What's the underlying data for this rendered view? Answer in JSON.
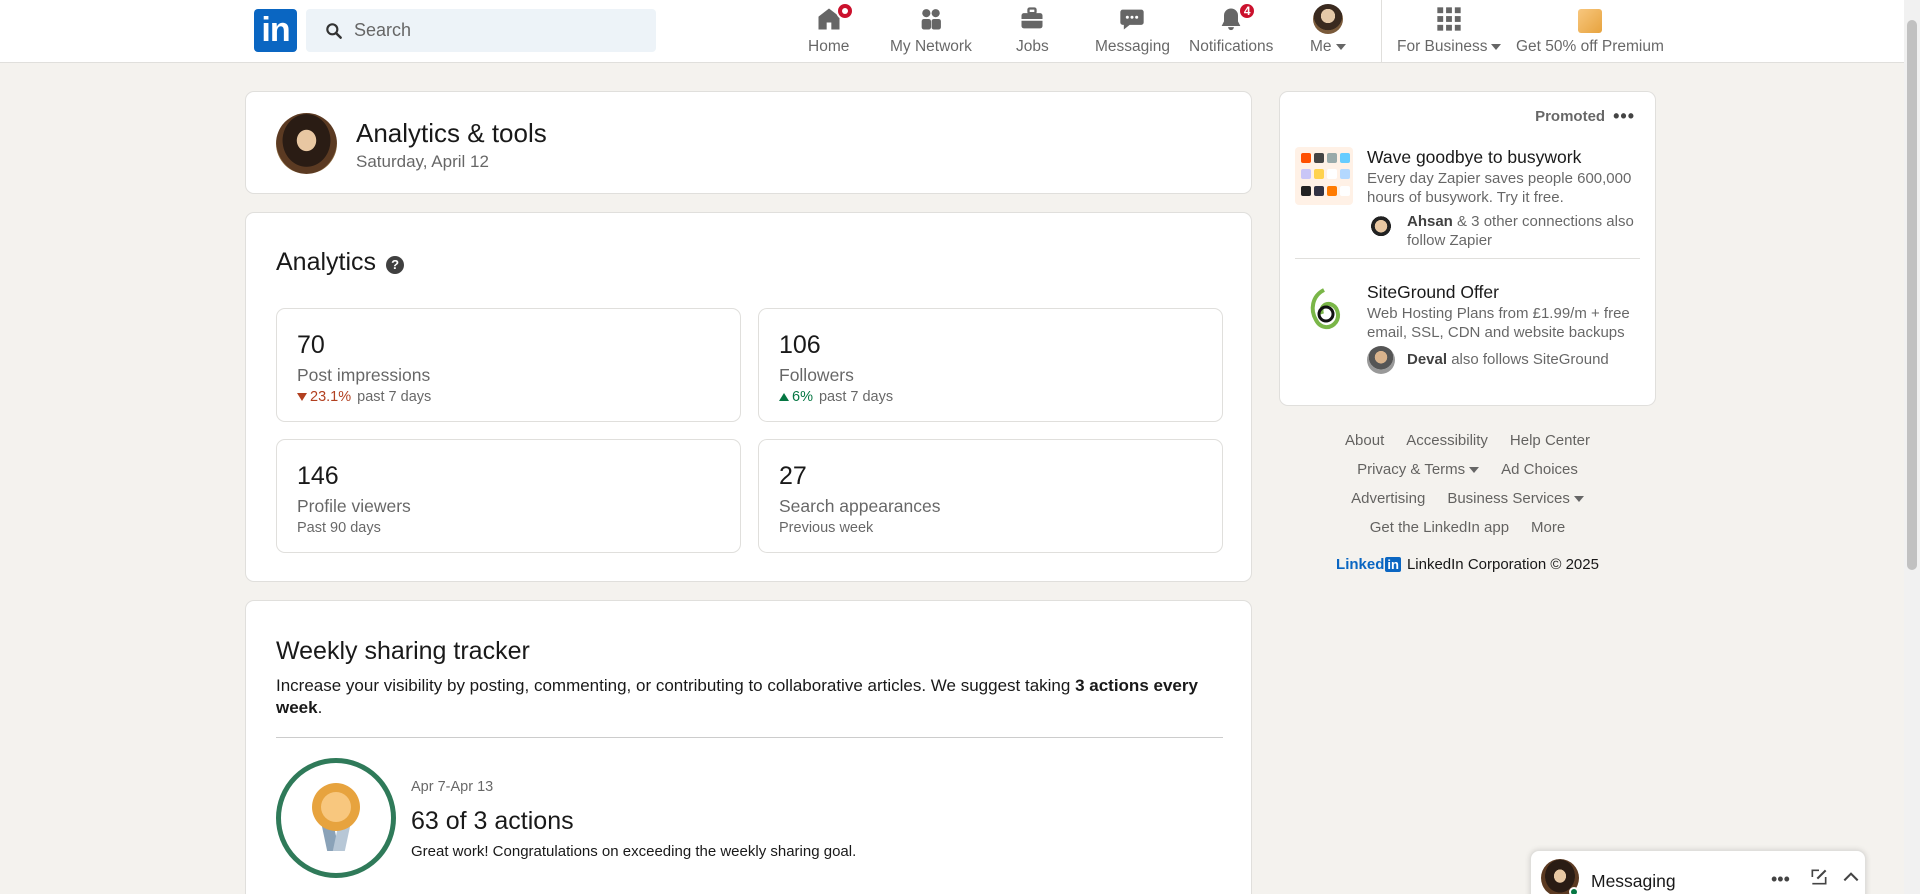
{
  "header": {
    "search_placeholder": "Search",
    "nav": [
      {
        "label": "Home",
        "badge": ""
      },
      {
        "label": "My Network",
        "badge": ""
      },
      {
        "label": "Jobs",
        "badge": ""
      },
      {
        "label": "Messaging",
        "badge": ""
      },
      {
        "label": "Notifications",
        "badge": "4"
      },
      {
        "label": "Me",
        "badge": ""
      }
    ],
    "for_business": "For Business",
    "premium": "Get 50% off Premium"
  },
  "top_card": {
    "title": "Analytics & tools",
    "date": "Saturday, April 12"
  },
  "analytics": {
    "title": "Analytics",
    "stats": [
      {
        "value": "70",
        "label": "Post impressions",
        "change": "23.1%",
        "period": "past 7 days"
      },
      {
        "value": "106",
        "label": "Followers",
        "change": "6%",
        "period": "past 7 days"
      },
      {
        "value": "146",
        "label": "Profile viewers",
        "period": "Past 90 days"
      },
      {
        "value": "27",
        "label": "Search appearances",
        "period": "Previous week"
      }
    ]
  },
  "tracker": {
    "title": "Weekly sharing tracker",
    "desc_prefix": "Increase your visibility by posting, commenting, or contributing to collaborative articles. We suggest taking ",
    "desc_bold": "3 actions every week",
    "desc_suffix": ".",
    "range": "Apr 7-Apr 13",
    "count": "63 of 3 actions",
    "note": "Great work! Congratulations on exceeding the weekly sharing goal."
  },
  "ads": {
    "promoted": "Promoted",
    "items": [
      {
        "title": "Wave goodbye to busywork",
        "desc": "Every day Zapier saves people 600,000 hours of busywork. Try it free.",
        "conn_name": "Ahsan",
        "conn_text": " & 3 other connections also follow Zapier"
      },
      {
        "title": "SiteGround Offer",
        "desc": "Web Hosting Plans from £1.99/m + free email, SSL, CDN and website backups",
        "conn_name": "Deval",
        "conn_text": " also follows SiteGround"
      }
    ]
  },
  "footer": {
    "about": "About",
    "accessibility": "Accessibility",
    "help": "Help Center",
    "privacy": "Privacy & Terms",
    "adchoices": "Ad Choices",
    "advertising": "Advertising",
    "business": "Business Services",
    "app": "Get the LinkedIn app",
    "more": "More",
    "brand": "Linked",
    "brand_box": "in",
    "copyright": "LinkedIn Corporation © 2025"
  },
  "messaging": {
    "title": "Messaging"
  },
  "colors": {
    "brand": "#0a66c2",
    "negative": "#b24020",
    "positive": "#057642",
    "badge": "#cb112d"
  }
}
